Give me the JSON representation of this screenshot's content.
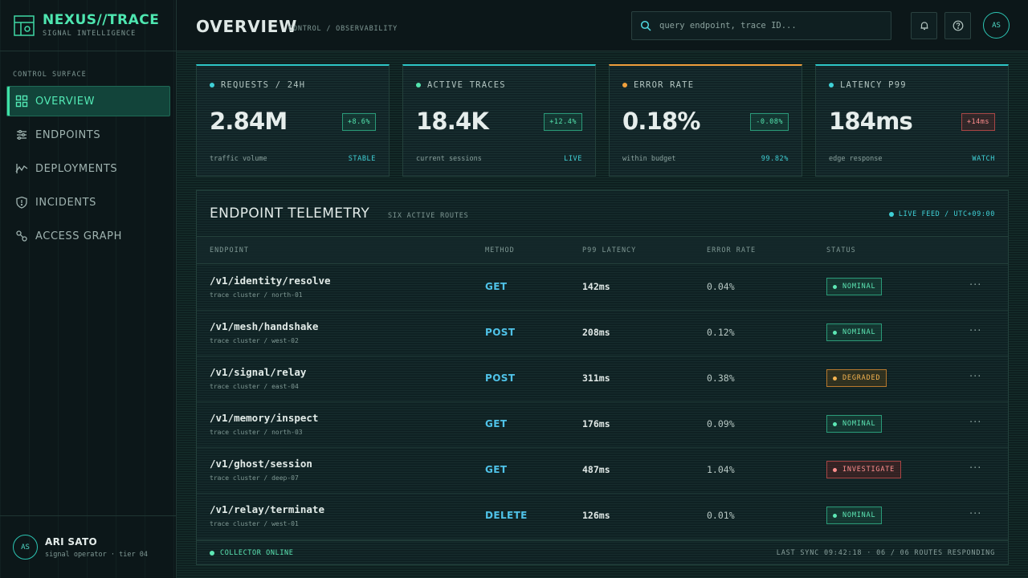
{
  "brand": {
    "title": "NEXUS//TRACE",
    "subtitle": "SIGNAL INTELLIGENCE"
  },
  "sidebar": {
    "section_label": "CONTROL SURFACE",
    "items": [
      {
        "label": "OVERVIEW",
        "icon": "grid-icon",
        "active": true
      },
      {
        "label": "ENDPOINTS",
        "icon": "sliders-icon"
      },
      {
        "label": "DEPLOYMENTS",
        "icon": "pulse-icon"
      },
      {
        "label": "INCIDENTS",
        "icon": "shield-icon"
      },
      {
        "label": "ACCESS GRAPH",
        "icon": "link-icon"
      }
    ],
    "user": {
      "initials": "AS",
      "name": "ARI SATO",
      "role": "signal operator · tier 04"
    }
  },
  "header": {
    "title": "OVERVIEW",
    "crumb": "CONTROL / OBSERVABILITY",
    "search_placeholder": "query endpoint, trace ID...",
    "avatar_initials": "AS"
  },
  "cards": [
    {
      "label": "REQUESTS / 24H",
      "value": "2.84M",
      "delta": "+8.6%",
      "delta_kind": "good",
      "foot": "traffic volume",
      "tag": "STABLE",
      "accent": "#2ec7c7"
    },
    {
      "label": "ACTIVE TRACES",
      "value": "18.4K",
      "delta": "+12.4%",
      "delta_kind": "good",
      "foot": "current sessions",
      "tag": "LIVE",
      "accent": "#2ec7c7"
    },
    {
      "label": "ERROR RATE",
      "value": "0.18%",
      "delta": "-0.08%",
      "delta_kind": "good",
      "foot": "within budget",
      "tag": "99.82%",
      "accent": "#f0a03c"
    },
    {
      "label": "LATENCY P99",
      "value": "184ms",
      "delta": "+14ms",
      "delta_kind": "bad",
      "foot": "edge response",
      "tag": "WATCH",
      "accent": "#2ec7c7"
    }
  ],
  "table": {
    "title": "ENDPOINT TELEMETRY",
    "subtitle": "SIX ACTIVE ROUTES",
    "live": "LIVE FEED / UTC+09:00",
    "columns": [
      "ENDPOINT",
      "METHOD",
      "P99 LATENCY",
      "ERROR RATE",
      "STATUS"
    ],
    "rows": [
      {
        "endpoint": "/v1/identity/resolve",
        "sub": "trace cluster / north-01",
        "method": "GET",
        "latency": "142ms",
        "error": "0.04%",
        "status": "NOMINAL",
        "kind": "ok"
      },
      {
        "endpoint": "/v1/mesh/handshake",
        "sub": "trace cluster / west-02",
        "method": "POST",
        "latency": "208ms",
        "error": "0.12%",
        "status": "NOMINAL",
        "kind": "ok"
      },
      {
        "endpoint": "/v1/signal/relay",
        "sub": "trace cluster / east-04",
        "method": "POST",
        "latency": "311ms",
        "error": "0.38%",
        "status": "DEGRADED",
        "kind": "deg"
      },
      {
        "endpoint": "/v1/memory/inspect",
        "sub": "trace cluster / north-03",
        "method": "GET",
        "latency": "176ms",
        "error": "0.09%",
        "status": "NOMINAL",
        "kind": "ok"
      },
      {
        "endpoint": "/v1/ghost/session",
        "sub": "trace cluster / deep-07",
        "method": "GET",
        "latency": "487ms",
        "error": "1.04%",
        "status": "INVESTIGATE",
        "kind": "inv"
      },
      {
        "endpoint": "/v1/relay/terminate",
        "sub": "trace cluster / west-01",
        "method": "DELETE",
        "latency": "126ms",
        "error": "0.01%",
        "status": "NOMINAL",
        "kind": "ok"
      }
    ],
    "footer": {
      "collector": "COLLECTOR ONLINE",
      "sync": "LAST SYNC 09:42:18 · 06 / 06 ROUTES RESPONDING"
    }
  }
}
